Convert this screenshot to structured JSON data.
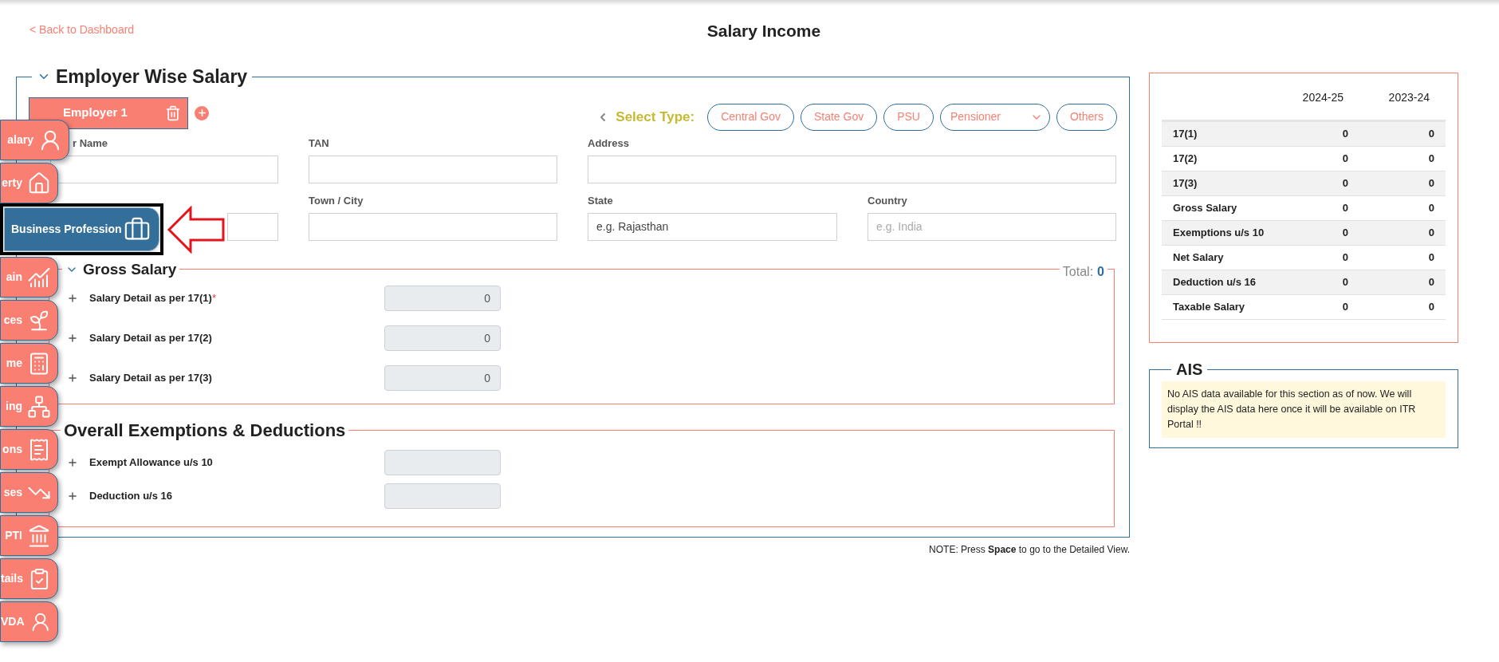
{
  "back_link": "< Back to Dashboard",
  "page_title": "Salary Income",
  "employer_section": {
    "title": "Employer Wise Salary",
    "expanded": true,
    "employer_tabs": [
      {
        "label": "Employer 1",
        "selected": true
      }
    ],
    "select_type_label": "Select Type:",
    "type_options": [
      {
        "kind": "button",
        "label": "Central Gov"
      },
      {
        "kind": "button",
        "label": "State Gov"
      },
      {
        "kind": "button",
        "label": "PSU"
      },
      {
        "kind": "dropdown",
        "label": "Pensioner"
      },
      {
        "kind": "button",
        "label": "Others"
      }
    ],
    "fields_row_1": [
      {
        "label": "r Name"
      },
      {
        "label": "TAN"
      },
      {
        "label": "Address"
      }
    ],
    "fields_row_2": [
      {
        "label": "Town / City"
      },
      {
        "label": "State",
        "value": "e.g. Rajasthan"
      },
      {
        "label": "Country",
        "placeholder": "e.g. India"
      }
    ]
  },
  "gross_salary": {
    "title": "Gross Salary",
    "expanded": true,
    "total_label": "Total:",
    "total_value": "0",
    "rows": [
      {
        "label": "Salary Detail as per 17(1)",
        "required_mark": "*",
        "value": "0"
      },
      {
        "label": "Salary Detail as per 17(2)",
        "value": "0"
      },
      {
        "label": "Salary Detail as per 17(3)",
        "value": "0"
      }
    ]
  },
  "exemptions": {
    "title": "Overall Exemptions & Deductions",
    "rows": [
      {
        "label": "Exempt Allowance u/s 10"
      },
      {
        "label": "Deduction u/s 16"
      }
    ]
  },
  "note": "NOTE: Press **Space** to go to the Detailed View.",
  "summary_table": {
    "columns": [
      "2024-25",
      "2023-24"
    ],
    "rows": [
      {
        "label": "17(1)",
        "values": [
          "0",
          "0"
        ]
      },
      {
        "label": "17(2)",
        "values": [
          "0",
          "0"
        ]
      },
      {
        "label": "17(3)",
        "values": [
          "0",
          "0"
        ]
      },
      {
        "label": "Gross Salary",
        "values": [
          "0",
          "0"
        ]
      },
      {
        "label": "Exemptions u/s 10",
        "values": [
          "0",
          "0"
        ]
      },
      {
        "label": "Net Salary",
        "values": [
          "0",
          "0"
        ]
      },
      {
        "label": "Deduction u/s 16",
        "values": [
          "0",
          "0"
        ]
      },
      {
        "label": "Taxable Salary",
        "values": [
          "0",
          "0"
        ]
      }
    ]
  },
  "ais": {
    "title": "AIS",
    "message": "No AIS data available for this section as of now. We will display the AIS data here once it will be available on ITR Portal !!"
  },
  "side_menu": [
    {
      "label": "alary",
      "selected": false
    },
    {
      "label": "erty",
      "selected": false
    },
    {
      "label": "Business Profession",
      "selected": true
    },
    {
      "label": "ain",
      "selected": false
    },
    {
      "label": "ces",
      "selected": false
    },
    {
      "label": "me",
      "selected": false
    },
    {
      "label": "ing",
      "selected": false
    },
    {
      "label": "ons",
      "selected": false
    },
    {
      "label": "ses",
      "selected": false
    },
    {
      "label": "PTI",
      "selected": false
    },
    {
      "label": "tails",
      "selected": false
    },
    {
      "label": "VDA",
      "selected": false
    }
  ]
}
